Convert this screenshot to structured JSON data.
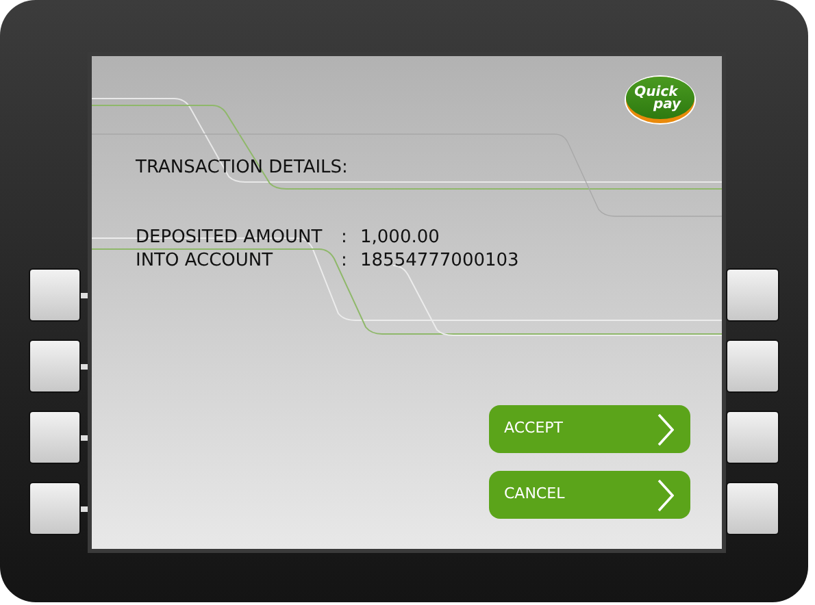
{
  "logo": {
    "line_1": "Quick",
    "line_2": "pay"
  },
  "heading": "TRANSACTION DETAILS:",
  "details": [
    {
      "label": "DEPOSITED AMOUNT",
      "separator": ":",
      "value": "1,000.00"
    },
    {
      "label": "INTO ACCOUNT",
      "separator": ":",
      "value": "18554777000103"
    }
  ],
  "buttons": [
    {
      "label": "ACCEPT"
    },
    {
      "label": "CANCEL"
    }
  ]
}
